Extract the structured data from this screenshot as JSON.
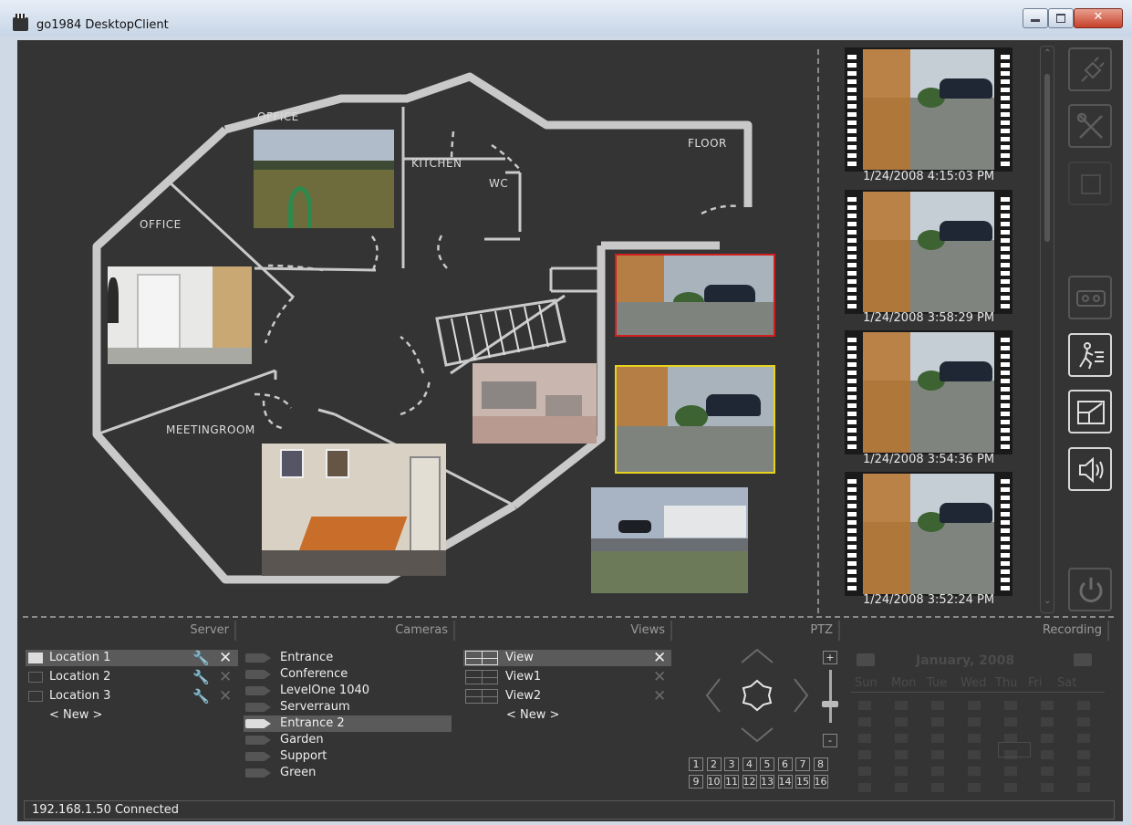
{
  "window": {
    "title": "go1984 DesktopClient"
  },
  "floorplan": {
    "rooms": [
      "OFFICE",
      "KITCHEN",
      "WC",
      "FLOOR",
      "OFFICE",
      "MEETINGROOM"
    ]
  },
  "film_strip": {
    "timestamps": [
      "1/24/2008 4:15:03 PM",
      "1/24/2008 3:58:29 PM",
      "1/24/2008 3:54:36 PM",
      "1/24/2008 3:52:24 PM"
    ]
  },
  "toolbar": {
    "icons": [
      "plug-icon",
      "tools-icon",
      "save-icon",
      "recorder-icon",
      "motion-icon",
      "resize-icon",
      "speaker-icon",
      "power-icon"
    ]
  },
  "sections": {
    "server": "Server",
    "cameras": "Cameras",
    "views": "Views",
    "ptz": "PTZ",
    "recording": "Recording"
  },
  "server": {
    "items": [
      "Location 1",
      "Location 2",
      "Location 3"
    ],
    "new_label": "< New >",
    "selected": "Location 1"
  },
  "cameras": {
    "items": [
      "Entrance",
      "Conference",
      "LevelOne 1040",
      "Serverraum",
      "Entrance 2",
      "Garden",
      "Support",
      "Green"
    ],
    "selected": "Entrance 2"
  },
  "views": {
    "items": [
      "View",
      "View1",
      "View2"
    ],
    "new_label": "< New >",
    "selected": "View"
  },
  "ptz": {
    "zoom_in": "+",
    "zoom_out": "-",
    "presets": [
      "1",
      "2",
      "3",
      "4",
      "5",
      "6",
      "7",
      "8",
      "9",
      "10",
      "11",
      "12",
      "13",
      "14",
      "15",
      "16"
    ]
  },
  "recording": {
    "month": "January, 2008",
    "weekdays": [
      "Sun",
      "Mon",
      "Tue",
      "Wed",
      "Thu",
      "Fri",
      "Sat"
    ]
  },
  "status": {
    "text": "192.168.1.50 Connected"
  },
  "colors": {
    "background": "#343434",
    "selected_red": "#d01f1f",
    "selected_yellow": "#e6d31e"
  }
}
